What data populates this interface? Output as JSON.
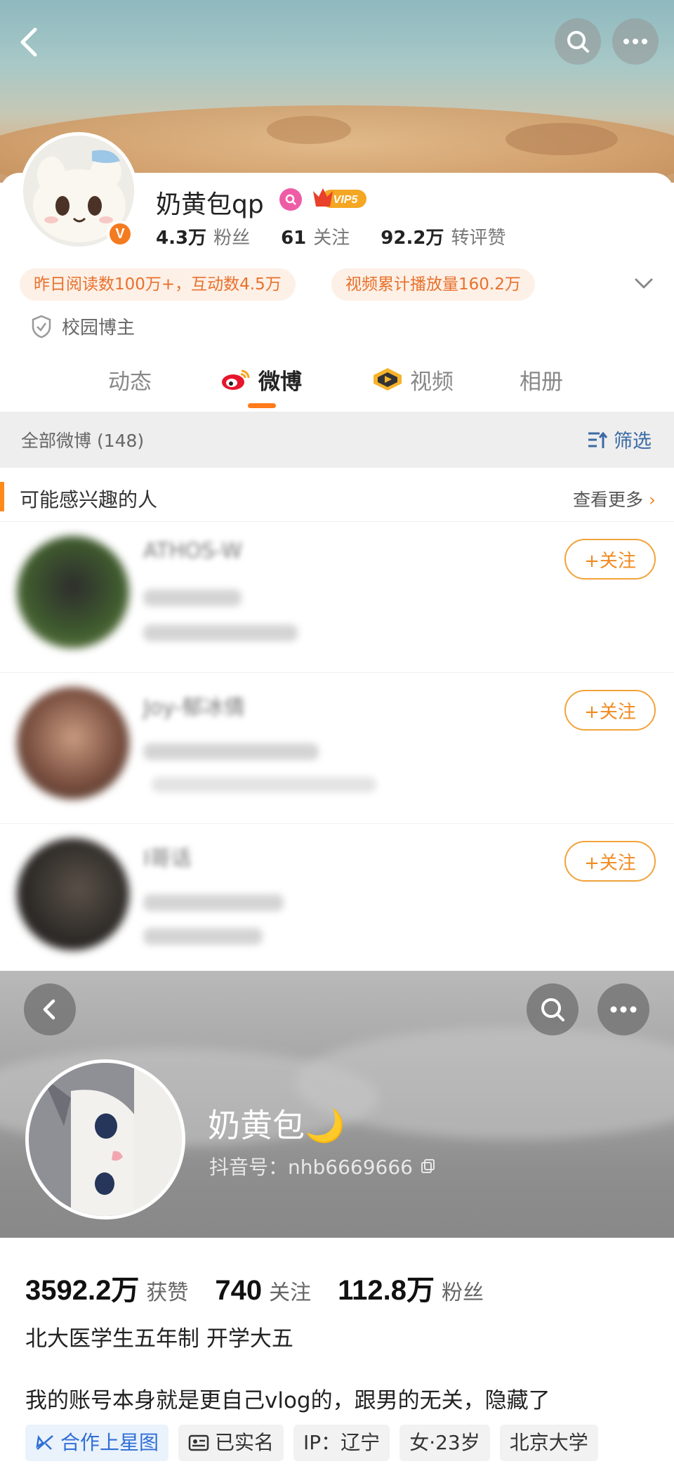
{
  "weibo": {
    "nav": {
      "back_icon": "chevron-left-icon",
      "search_icon": "search-icon",
      "more_icon": "more-dots-icon"
    },
    "profile": {
      "name": "奶黄包qp",
      "verified_badge": "V",
      "vip_label": "VIP5",
      "stats": [
        {
          "value": "4.3万",
          "label": "粉丝"
        },
        {
          "value": "61",
          "label": "关注"
        },
        {
          "value": "92.2万",
          "label": "转评赞"
        }
      ],
      "highlights": [
        "昨日阅读数100万+，互动数4.5万",
        "视频累计播放量160.2万"
      ],
      "campus_label": "校园博主"
    },
    "tabs": [
      {
        "label": "动态",
        "active": false
      },
      {
        "label": "微博",
        "active": true
      },
      {
        "label": "视频",
        "active": false
      },
      {
        "label": "相册",
        "active": false
      }
    ],
    "filter_bar": {
      "all_label": "全部微博 (148)",
      "filter_label": "筛选"
    },
    "recommend": {
      "title": "可能感兴趣的人",
      "more_label": "查看更多",
      "follow_label": "+关注",
      "users": [
        {
          "name": "ATHOS-W"
        },
        {
          "name": "Joy-郁冰倩"
        },
        {
          "name": "I哥话"
        }
      ]
    },
    "accent_color": "#ff7a1a"
  },
  "douyin": {
    "nav": {
      "back_icon": "chevron-left-icon",
      "search_icon": "search-icon",
      "more_icon": "more-dots-icon"
    },
    "profile": {
      "name": "奶黄包🌙",
      "id_label": "抖音号：nhb6669666",
      "stats": [
        {
          "value": "3592.2万",
          "label": "获赞"
        },
        {
          "value": "740",
          "label": "关注"
        },
        {
          "value": "112.8万",
          "label": "粉丝"
        }
      ],
      "bio_line1": "北大医学生五年制  开学大五",
      "bio_line2": "我的账号本身就是更自己vlog的，跟男的无关，隐藏了",
      "tags": [
        "合作上星图",
        "已实名",
        "IP：辽宁",
        "女·23岁",
        "北京大学"
      ]
    }
  }
}
